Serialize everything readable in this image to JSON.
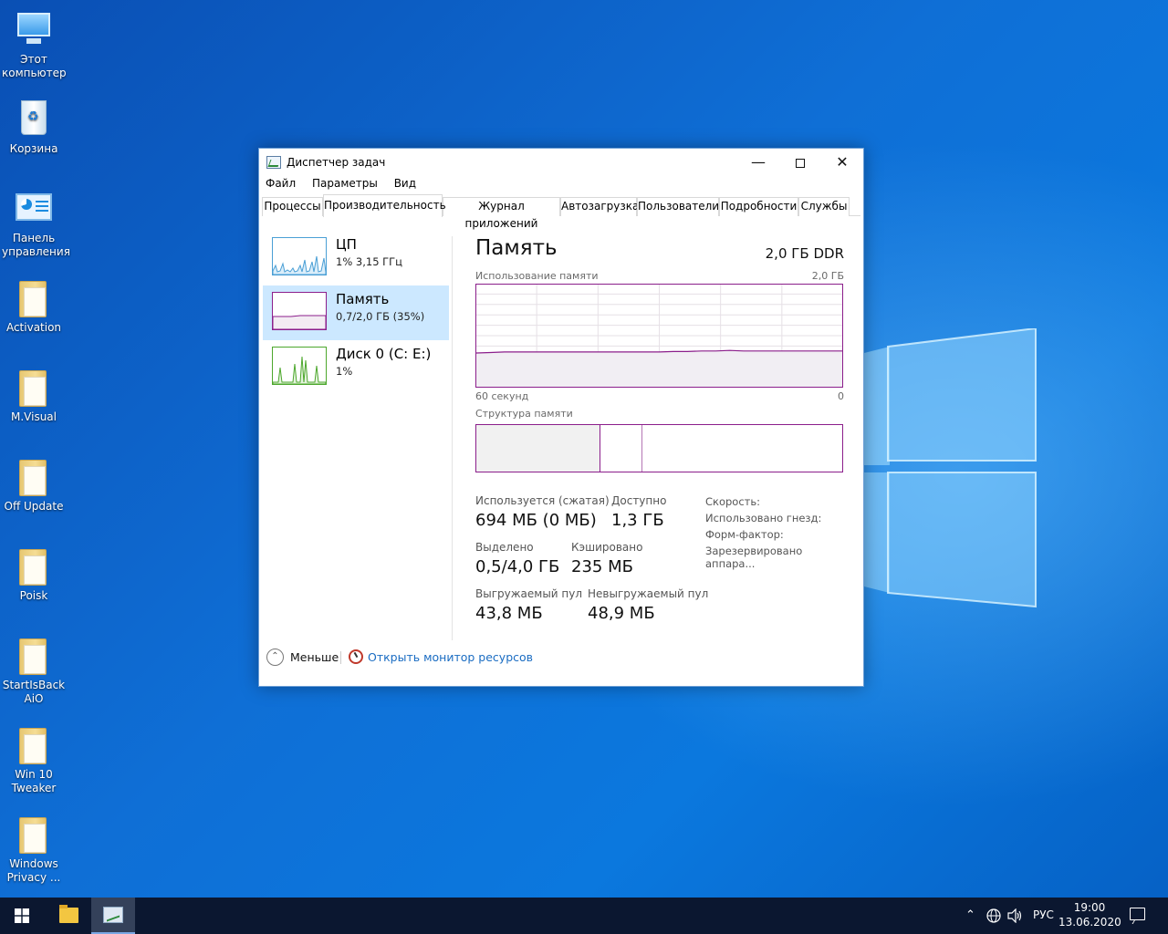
{
  "desktop": {
    "icons": [
      {
        "label": "Этот компьютер",
        "kind": "computer-icon"
      },
      {
        "label": "Корзина",
        "kind": "recycle-bin-icon"
      },
      {
        "label": "Панель управления",
        "kind": "control-panel-icon"
      },
      {
        "label": "Activation",
        "kind": "folder-icon"
      },
      {
        "label": "M.Visual",
        "kind": "folder-icon"
      },
      {
        "label": "Off Update",
        "kind": "folder-icon"
      },
      {
        "label": "Poisk",
        "kind": "folder-icon"
      },
      {
        "label": "StartIsBack AiO",
        "kind": "folder-icon"
      },
      {
        "label": "Win 10 Tweaker",
        "kind": "folder-icon"
      },
      {
        "label": "Windows Privacy ...",
        "kind": "folder-icon"
      }
    ]
  },
  "window": {
    "title": "Диспетчер задач",
    "menu": [
      "Файл",
      "Параметры",
      "Вид"
    ],
    "tabs": [
      "Процессы",
      "Производительность",
      "Журнал приложений",
      "Автозагрузка",
      "Пользователи",
      "Подробности",
      "Службы"
    ],
    "active_tab": "Производительность",
    "perf_items": [
      {
        "title": "ЦП",
        "sub": "1% 3,15 ГГц",
        "color": "#4a9fd5"
      },
      {
        "title": "Память",
        "sub": "0,7/2,0 ГБ (35%)",
        "color": "#8b1e8b"
      },
      {
        "title": "Диск 0 (C: E:)",
        "sub": "1%",
        "color": "#4ca72c"
      }
    ],
    "memory": {
      "title": "Память",
      "type": "2,0 ГБ DDR",
      "usage_label": "Использование памяти",
      "usage_max": "2,0 ГБ",
      "time_left": "60 секунд",
      "time_right": "0",
      "composition_label": "Структура памяти",
      "composition": {
        "in_use_fraction": 0.34,
        "modified_fraction": 0.115
      },
      "stats": {
        "in_use_label": "Используется (сжатая)",
        "in_use_value": "694 МБ (0 МБ)",
        "available_label": "Доступно",
        "available_value": "1,3 ГБ",
        "committed_label": "Выделено",
        "committed_value": "0,5/4,0 ГБ",
        "cached_label": "Кэшировано",
        "cached_value": "235 МБ",
        "paged_label": "Выгружаемый пул",
        "paged_value": "43,8 МБ",
        "nonpaged_label": "Невыгружаемый пул",
        "nonpaged_value": "48,9 МБ"
      },
      "side": [
        "Скорость:",
        "Использовано гнезд:",
        "Форм-фактор:",
        "Зарезервировано аппара..."
      ]
    },
    "footer": {
      "less": "Меньше",
      "monitor": "Открыть монитор ресурсов"
    }
  },
  "chart_data": {
    "type": "line",
    "title": "Использование памяти",
    "x_range": [
      60,
      0
    ],
    "ylim": [
      0,
      2.0
    ],
    "series": [
      {
        "values": [
          0.66,
          0.67,
          0.68,
          0.68,
          0.68,
          0.68,
          0.68,
          0.68,
          0.68,
          0.68,
          0.68,
          0.68,
          0.68,
          0.68,
          0.69,
          0.69,
          0.7,
          0.7,
          0.71,
          0.7,
          0.7,
          0.7,
          0.7,
          0.7,
          0.7,
          0.7,
          0.7
        ]
      }
    ],
    "colors": {
      "line": "#8b1e8b",
      "fill": "#f1eef3",
      "grid": "#e6e0e6"
    }
  },
  "taskbar": {
    "language": "РУС",
    "time": "19:00",
    "date": "13.06.2020"
  }
}
